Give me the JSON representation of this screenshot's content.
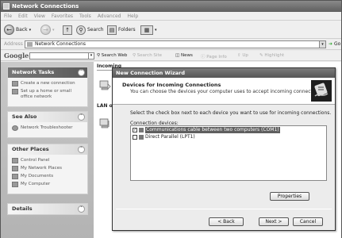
{
  "window": {
    "title": "Network Connections"
  },
  "menu": [
    "File",
    "Edit",
    "View",
    "Favorites",
    "Tools",
    "Advanced",
    "Help"
  ],
  "toolbar": {
    "back_label": "Back",
    "search_label": "Search",
    "folders_label": "Folders"
  },
  "address": {
    "label": "Address",
    "value": "Network Connections",
    "go_label": "Go"
  },
  "googlebar": {
    "logo": "Google",
    "search_web": "Search Web",
    "search_site": "Search Site",
    "news": "News",
    "page_info": "Page Info",
    "up": "Up",
    "highlight": "Highlight"
  },
  "sidebar": {
    "network_tasks": {
      "title": "Network Tasks",
      "items": [
        "Create a new connection",
        "Set up a home or small office network"
      ]
    },
    "see_also": {
      "title": "See Also",
      "items": [
        "Network Troubleshooter"
      ]
    },
    "other_places": {
      "title": "Other Places",
      "items": [
        "Control Panel",
        "My Network Places",
        "My Documents",
        "My Computer"
      ]
    },
    "details": {
      "title": "Details"
    }
  },
  "content": {
    "group_incoming": "Incoming",
    "group_lan": "LAN or"
  },
  "wizard": {
    "title": "New Connection Wizard",
    "header_title": "Devices for Incoming Connections",
    "header_subtitle": "You can choose the devices your computer uses to accept incoming connections.",
    "description": "Select the check box next to each device you want to use for incoming connections.",
    "devices_label": "Connection devices:",
    "devices": [
      {
        "label": "Communications cable between two computers (COM1)",
        "checked": true,
        "selected": true
      },
      {
        "label": "Direct Parallel (LPT1)",
        "checked": false,
        "selected": false
      }
    ],
    "properties_button": "Properties",
    "back_button": "< Back",
    "next_button": "Next >",
    "cancel_button": "Cancel"
  }
}
